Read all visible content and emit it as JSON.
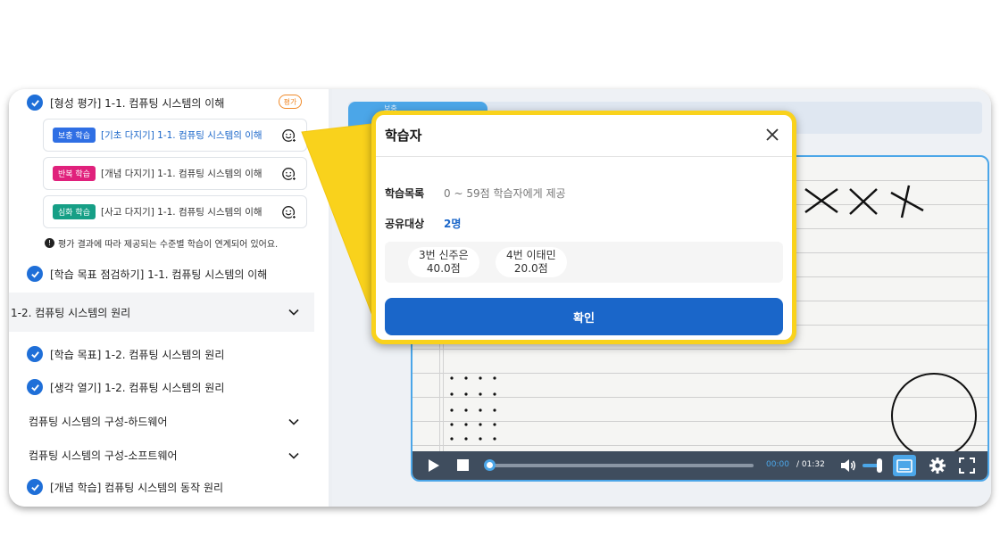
{
  "sidebar": {
    "eval_item": {
      "label": "[형성 평가] 1-1. 컴퓨팅 시스템의 이해",
      "badge": "평가"
    },
    "cards": [
      {
        "chip": "보충 학습",
        "chip_color": "#2f6fe4",
        "label": "[기초 다지기] 1-1. 컴퓨팅 시스템의 이해",
        "label_color": "#1a66c9"
      },
      {
        "chip": "반복 학습",
        "chip_color": "#e0217c",
        "label": "[개념 다지기] 1-1. 컴퓨팅 시스템의 이해",
        "label_color": "#333333"
      },
      {
        "chip": "심화 학습",
        "chip_color": "#169f86",
        "label": "[사고 다지기] 1-1. 컴퓨팅 시스템의 이해",
        "label_color": "#333333"
      }
    ],
    "info_note": "평가 결과에 따라 제공되는 수준별 학습이 연계되어 있어요.",
    "goal_check": "[학습 목표 점검하기] 1-1. 컴퓨팅 시스템의 이해",
    "section_title": "1-2. 컴퓨팅 시스템의 원리",
    "items": [
      {
        "label": "[학습 목표] 1-2. 컴퓨팅 시스템의 원리",
        "type": "check"
      },
      {
        "label": "[생각 열기] 1-2. 컴퓨팅 시스템의 원리",
        "type": "check"
      },
      {
        "label": "컴퓨팅 시스템의 구성-하드웨어",
        "type": "expand"
      },
      {
        "label": "컴퓨팅 시스템의 구성-소프트웨어",
        "type": "expand"
      },
      {
        "label": "[개념 학습] 컴퓨팅 시스템의 동작 원리",
        "type": "check"
      }
    ]
  },
  "main": {
    "tab_label": "보충"
  },
  "video": {
    "current_time": "00:00",
    "total_time": "/ 01:32",
    "progress": 0.0,
    "volume": 1.0
  },
  "modal": {
    "title": "학습자",
    "list_label": "학습목록",
    "list_value": "0 ~ 59점 학습자에게 제공",
    "share_label": "공유대상",
    "share_value": "2명",
    "students": [
      {
        "name": "3번 신주은",
        "score": "40.0점"
      },
      {
        "name": "4번 이태민",
        "score": "20.0점"
      }
    ],
    "confirm": "확인"
  },
  "colors": {
    "accent_blue": "#1a66c9",
    "callout_yellow": "#f9d21c",
    "player_blue": "#4ba6e8"
  }
}
